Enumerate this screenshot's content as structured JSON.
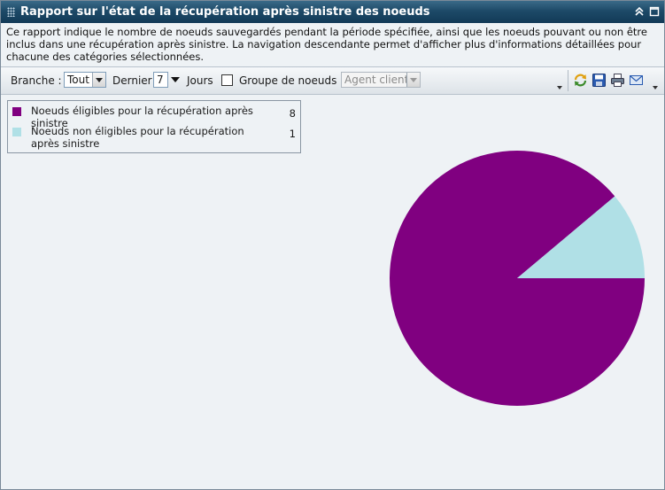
{
  "window": {
    "title": "Rapport sur l'état de la récupération après sinistre des noeuds",
    "collapse_icon": "double-chevron-up-icon",
    "maximize_icon": "maximize-icon"
  },
  "description": "Ce rapport indique le nombre de noeuds sauvegardés pendant la période spécifiée, ainsi que les noeuds pouvant ou non être inclus dans une récupération après sinistre. La navigation descendante permet d'afficher plus d'informations détaillées pour chacune des catégories sélectionnées.",
  "filters": {
    "branch_label": "Branche :",
    "branch_value": "Tout",
    "last_label": "Dernier",
    "last_value": "7",
    "days_label": "Jours",
    "node_group_checked": false,
    "node_group_label": "Groupe de noeuds :",
    "node_group_value": "Agent client"
  },
  "actions": [
    "refresh-icon",
    "save-icon",
    "print-icon",
    "email-icon"
  ],
  "colors": {
    "eligible": "#800080",
    "not_eligible": "#b0e0e6",
    "title_bar": "#1d4a68"
  },
  "chart_data": {
    "type": "pie",
    "title": "",
    "legend_position": "top-left",
    "slices": [
      {
        "label": "Noeuds éligibles pour la récupération après sinistre",
        "value": 8,
        "color": "#800080"
      },
      {
        "label": "Noeuds non éligibles pour la récupération après sinistre",
        "value": 1,
        "color": "#b0e0e6"
      }
    ]
  }
}
